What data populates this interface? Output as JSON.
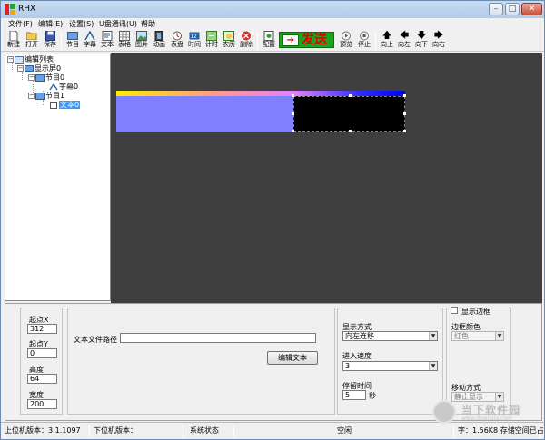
{
  "window": {
    "title": "RHX"
  },
  "menu": [
    "文件(F)",
    "编辑(E)",
    "设置(S)",
    "U盘通讯(U)",
    "帮助"
  ],
  "toolbar": {
    "items": [
      {
        "label": "新建",
        "icon": "new-file-icon"
      },
      {
        "label": "打开",
        "icon": "open-folder-icon"
      },
      {
        "label": "保存",
        "icon": "save-icon"
      },
      {
        "label": "节目",
        "icon": "program-icon"
      },
      {
        "label": "字幕",
        "icon": "subtitle-icon"
      },
      {
        "label": "文本",
        "icon": "text-icon"
      },
      {
        "label": "表格",
        "icon": "table-icon"
      },
      {
        "label": "图片",
        "icon": "picture-icon"
      },
      {
        "label": "动画",
        "icon": "animation-icon"
      },
      {
        "label": "表盘",
        "icon": "dial-icon"
      },
      {
        "label": "时间",
        "icon": "time-icon"
      },
      {
        "label": "计时",
        "icon": "timer-icon"
      },
      {
        "label": "农历",
        "icon": "lunar-calendar-icon"
      },
      {
        "label": "删除",
        "icon": "delete-icon"
      },
      {
        "label": "配置",
        "icon": "config-icon"
      },
      {
        "label": "预览",
        "icon": "preview-icon"
      },
      {
        "label": "停止",
        "icon": "stop-icon"
      },
      {
        "label": "向上",
        "icon": "arrow-up-icon"
      },
      {
        "label": "向左",
        "icon": "arrow-left-icon"
      },
      {
        "label": "向下",
        "icon": "arrow-down-icon"
      },
      {
        "label": "向右",
        "icon": "arrow-right-icon"
      }
    ],
    "send_label": "发送"
  },
  "tree": {
    "root": "编辑列表",
    "screen": "显示屏0",
    "program0": "节目0",
    "subtitle0": "字幕0",
    "program1": "节目1",
    "text0": "文本0"
  },
  "props": {
    "pos": {
      "x_label": "起点X",
      "x_value": "312",
      "y_label": "起点Y",
      "y_value": "0",
      "h_label": "高度",
      "h_value": "64",
      "w_label": "宽度",
      "w_value": "200"
    },
    "text": {
      "path_label": "文本文件路径",
      "path_value": "",
      "edit_button": "编辑文本"
    },
    "display": {
      "mode_label": "显示方式",
      "mode_value": "向左连移",
      "speed_label": "进入速度",
      "speed_value": "3",
      "stay_label": "停留时间",
      "stay_value": "5",
      "stay_unit": "秒"
    },
    "border": {
      "show_label": "显示边框",
      "color_label": "边框颜色",
      "color_value": "红色",
      "move_label": "移动方式",
      "move_value": "静止显示"
    }
  },
  "status": {
    "host_version": "上位机版本：3.1.1097",
    "device_version": "下位机版本：",
    "system_state": "系统状态",
    "idle": "空闲",
    "storage": "字：1.56K8 存储空间已占"
  },
  "watermark": {
    "text": "当下软件园",
    "url": "www.downxia.com"
  },
  "colors": {
    "send_bg": "#1ea51e",
    "send_text": "#e00000",
    "canvas": "#3f3f3f",
    "region_main": "#8080ff",
    "selection": "#3399ff"
  }
}
